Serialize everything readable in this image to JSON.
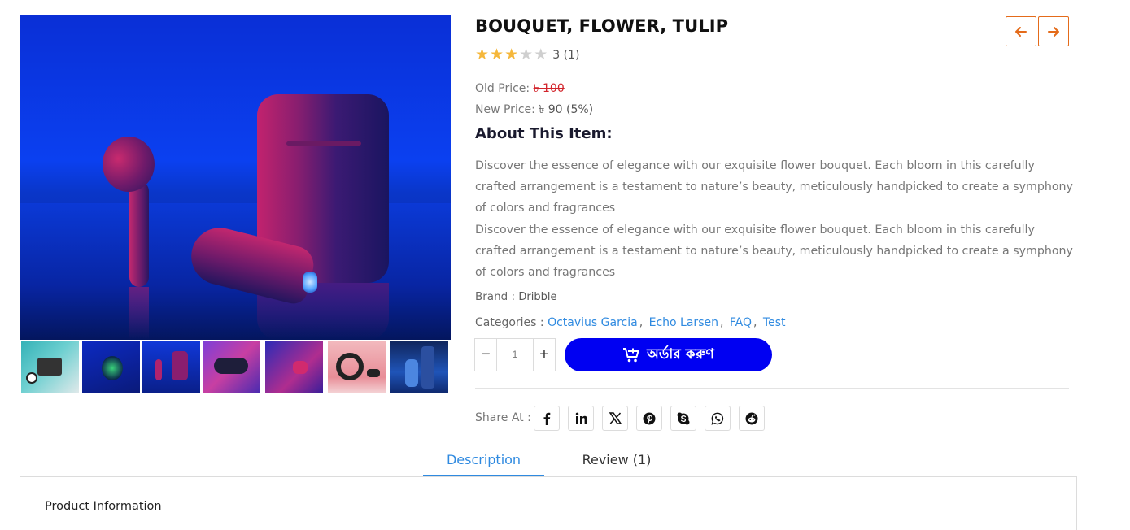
{
  "product": {
    "title": "BOUQUET, FLOWER, TULIP",
    "rating": {
      "score": 3,
      "max": 5,
      "text": "3 (1)"
    },
    "old_price_label": "Old Price:",
    "old_price_value": "৳ 100",
    "new_price_label": "New Price:",
    "new_price_value": "৳ 90 (5%)",
    "about_heading": "About This Item:",
    "description": [
      "Discover the essence of elegance with our exquisite flower bouquet. Each bloom in this carefully crafted arrangement is a testament to nature’s beauty, meticulously handpicked to create a symphony of colors and fragrances",
      "Discover the essence of elegance with our exquisite flower bouquet. Each bloom in this carefully crafted arrangement is a testament to nature’s beauty, meticulously handpicked to create a symphony of colors and fragrances"
    ],
    "brand_label": "Brand :",
    "brand_value": "Dribble",
    "categories_label": "Categories :",
    "categories": [
      "Octavius Garcia",
      "Echo Larsen",
      "FAQ",
      "Test"
    ]
  },
  "navigation": {
    "prev_icon": "arrow-left-icon",
    "next_icon": "arrow-right-icon"
  },
  "quantity": {
    "minus": "−",
    "value": "1",
    "plus": "+"
  },
  "order_button": {
    "label": "অর্ডার করুণ",
    "icon": "cart-plus-icon"
  },
  "share": {
    "label": "Share At :",
    "networks": [
      "facebook",
      "linkedin",
      "x",
      "pinterest",
      "skype",
      "whatsapp",
      "reddit"
    ]
  },
  "tabs": [
    {
      "label": "Description",
      "active": true
    },
    {
      "label": "Review (1)",
      "active": false
    }
  ],
  "panel": {
    "title": "Product Information"
  },
  "colors": {
    "accent": "#2f8ae0",
    "order_button": "#0000f2",
    "nav_border": "#e46b1a",
    "old_price": "#d2242b",
    "star": "#f5b73b"
  }
}
